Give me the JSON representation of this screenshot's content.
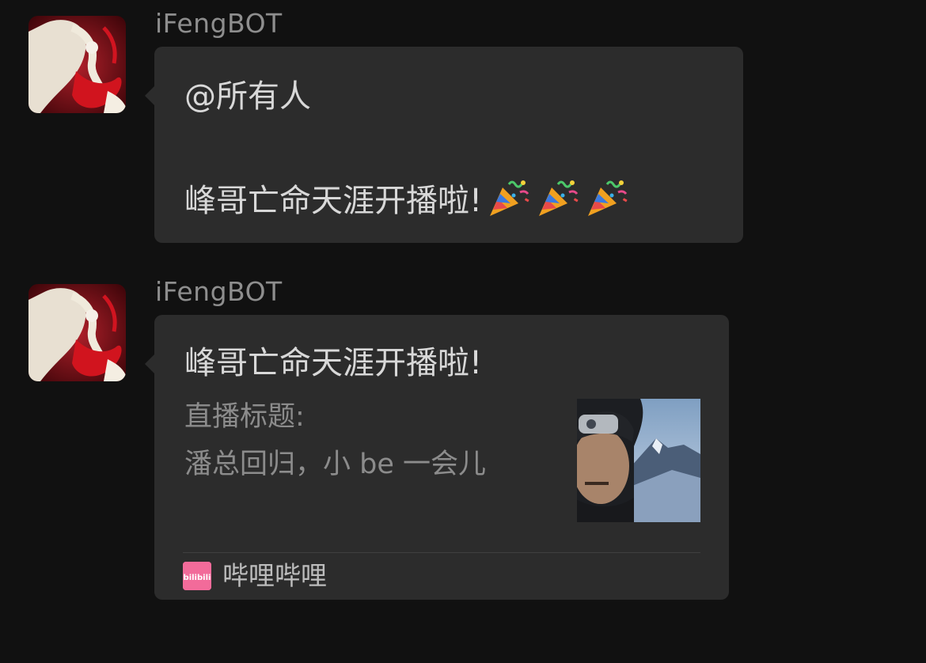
{
  "messages": [
    {
      "sender": "iFengBOT",
      "mention": "@所有人",
      "text": "峰哥亡命天涯开播啦!",
      "emoji": [
        "party-popper-icon",
        "party-popper-icon",
        "party-popper-icon"
      ]
    },
    {
      "sender": "iFengBOT",
      "card": {
        "title": "峰哥亡命天涯开播啦!",
        "subtitle_label": "直播标题:",
        "subtitle_value": "潘总回归，小 be 一会儿",
        "source_icon_text": "bilibili",
        "source_name": "哔哩哔哩"
      }
    }
  ],
  "colors": {
    "background": "#111111",
    "bubble": "#2c2c2c",
    "text": "#d8d8d8",
    "secondary_text": "#8c8c8c",
    "bilibili_pink": "#f26b9a"
  }
}
